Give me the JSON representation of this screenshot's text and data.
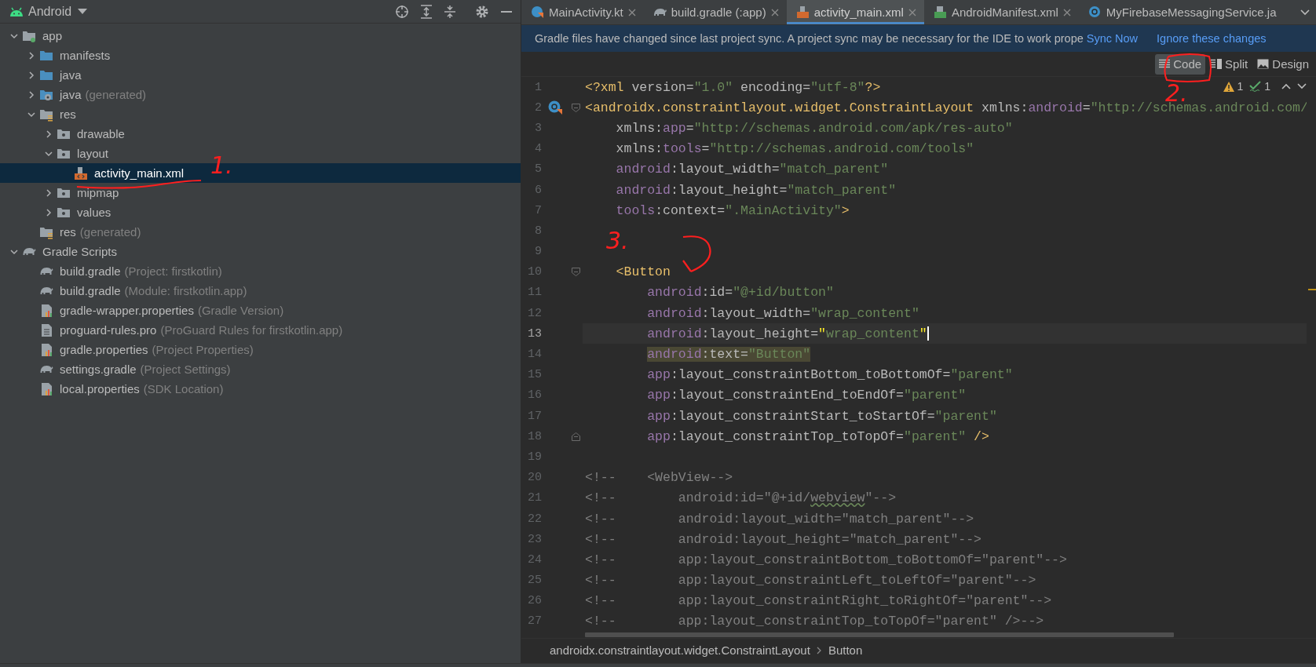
{
  "project_panel": {
    "view": "Android",
    "tree": [
      {
        "label": "app",
        "kind": "module",
        "expanded": true,
        "selected": false,
        "children": [
          {
            "label": "manifests",
            "kind": "folder-blue",
            "expanded": false,
            "selected": false
          },
          {
            "label": "java",
            "kind": "folder-blue",
            "expanded": false,
            "selected": false
          },
          {
            "label": "java",
            "note": "(generated)",
            "kind": "folder-gen",
            "expanded": false,
            "selected": false
          },
          {
            "label": "res",
            "kind": "folder-res",
            "expanded": true,
            "selected": false,
            "children": [
              {
                "label": "drawable",
                "kind": "folder",
                "expanded": false,
                "selected": false
              },
              {
                "label": "layout",
                "kind": "folder",
                "expanded": true,
                "selected": false,
                "children": [
                  {
                    "label": "activity_main.xml",
                    "kind": "xml",
                    "selected": true
                  }
                ]
              },
              {
                "label": "mipmap",
                "kind": "folder",
                "expanded": false,
                "selected": false
              },
              {
                "label": "values",
                "kind": "folder",
                "expanded": false,
                "selected": false
              }
            ]
          },
          {
            "label": "res",
            "note": "(generated)",
            "kind": "folder-res",
            "selected": false
          }
        ]
      },
      {
        "label": "Gradle Scripts",
        "kind": "gradle",
        "expanded": true,
        "selected": false,
        "children": [
          {
            "label": "build.gradle",
            "note": "(Project: firstkotlin)",
            "kind": "gradle",
            "selected": false
          },
          {
            "label": "build.gradle",
            "note": "(Module: firstkotlin.app)",
            "kind": "gradle",
            "selected": false
          },
          {
            "label": "gradle-wrapper.properties",
            "note": "(Gradle Version)",
            "kind": "properties",
            "selected": false
          },
          {
            "label": "proguard-rules.pro",
            "note": "(ProGuard Rules for firstkotlin.app)",
            "kind": "file",
            "selected": false
          },
          {
            "label": "gradle.properties",
            "note": "(Project Properties)",
            "kind": "properties",
            "selected": false
          },
          {
            "label": "settings.gradle",
            "note": "(Project Settings)",
            "kind": "gradle",
            "selected": false
          },
          {
            "label": "local.properties",
            "note": "(SDK Location)",
            "kind": "properties",
            "selected": false
          }
        ]
      }
    ]
  },
  "tabs": [
    {
      "label": "MainActivity.kt",
      "kind": "kotlin",
      "selected": false,
      "closable": true
    },
    {
      "label": "build.gradle (:app)",
      "kind": "gradle",
      "selected": false,
      "closable": true
    },
    {
      "label": "activity_main.xml",
      "kind": "xml",
      "selected": true,
      "closable": true
    },
    {
      "label": "AndroidManifest.xml",
      "kind": "manifest",
      "selected": false,
      "closable": true
    },
    {
      "label": "MyFirebaseMessagingService.ja",
      "kind": "class",
      "selected": false,
      "closable": false
    }
  ],
  "notification": {
    "message": "Gradle files have changed since last project sync. A project sync may be necessary for the IDE to work prope",
    "actions": [
      "Sync Now",
      "Ignore these changes"
    ]
  },
  "view_modes": [
    {
      "label": "Code",
      "kind": "code",
      "selected": true
    },
    {
      "label": "Split",
      "kind": "split",
      "selected": false
    },
    {
      "label": "Design",
      "kind": "design",
      "selected": false
    }
  ],
  "inspections": [
    {
      "kind": "warning",
      "count": "1"
    },
    {
      "kind": "ok",
      "count": "1"
    }
  ],
  "editor": {
    "lines": [
      {
        "number": "1",
        "kind": "normal",
        "tokens": [
          {
            "kind": "tag",
            "text": "<?xml"
          },
          {
            "kind": "attr",
            "text": " version="
          },
          {
            "kind": "str",
            "text": "\"1.0\""
          },
          {
            "kind": "attr",
            "text": " encoding="
          },
          {
            "kind": "str",
            "text": "\"utf-8\""
          },
          {
            "kind": "tag",
            "text": "?>"
          }
        ]
      },
      {
        "number": "2",
        "kind": "normal",
        "class_marker": true,
        "fold_start": true,
        "tokens": [
          {
            "kind": "tag",
            "text": "<androidx.constraintlayout.widget.ConstraintLayout"
          },
          {
            "kind": "attr",
            "text": " xmlns:"
          },
          {
            "kind": "ns",
            "text": "android"
          },
          {
            "kind": "attr",
            "text": "="
          },
          {
            "kind": "str",
            "text": "\"http://schemas.android.com/"
          }
        ]
      },
      {
        "number": "3",
        "kind": "normal",
        "tokens": [
          {
            "kind": "attr",
            "text": "    xmlns:"
          },
          {
            "kind": "ns",
            "text": "app"
          },
          {
            "kind": "attr",
            "text": "="
          },
          {
            "kind": "str",
            "text": "\"http://schemas.android.com/apk/res-auto\""
          }
        ]
      },
      {
        "number": "4",
        "kind": "normal",
        "tokens": [
          {
            "kind": "attr",
            "text": "    xmlns:"
          },
          {
            "kind": "ns",
            "text": "tools"
          },
          {
            "kind": "attr",
            "text": "="
          },
          {
            "kind": "str",
            "text": "\"http://schemas.android.com/tools\""
          }
        ]
      },
      {
        "number": "5",
        "kind": "normal",
        "tokens": [
          {
            "kind": "ns",
            "text": "    android"
          },
          {
            "kind": "attr",
            "text": ":layout_width="
          },
          {
            "kind": "str",
            "text": "\"match_parent\""
          }
        ]
      },
      {
        "number": "6",
        "kind": "normal",
        "tokens": [
          {
            "kind": "ns",
            "text": "    android"
          },
          {
            "kind": "attr",
            "text": ":layout_height="
          },
          {
            "kind": "str",
            "text": "\"match_parent\""
          }
        ]
      },
      {
        "number": "7",
        "kind": "normal",
        "tokens": [
          {
            "kind": "ns",
            "text": "    tools"
          },
          {
            "kind": "attr",
            "text": ":context="
          },
          {
            "kind": "str",
            "text": "\".MainActivity\""
          },
          {
            "kind": "tag",
            "text": ">"
          }
        ]
      },
      {
        "number": "8",
        "kind": "normal"
      },
      {
        "number": "9",
        "kind": "normal"
      },
      {
        "number": "10",
        "kind": "normal",
        "fold_start": true,
        "tokens": [
          {
            "kind": "tag",
            "text": "    <Button"
          }
        ]
      },
      {
        "number": "11",
        "kind": "normal",
        "tokens": [
          {
            "kind": "ns",
            "text": "        android"
          },
          {
            "kind": "attr",
            "text": ":id="
          },
          {
            "kind": "str",
            "text": "\"@+id/button\""
          }
        ]
      },
      {
        "number": "12",
        "kind": "normal",
        "tokens": [
          {
            "kind": "ns",
            "text": "        android"
          },
          {
            "kind": "attr",
            "text": ":layout_width="
          },
          {
            "kind": "str",
            "text": "\"wrap_content\""
          }
        ]
      },
      {
        "number": "13",
        "kind": "current",
        "tokens": [
          {
            "kind": "ns",
            "text": "        android"
          },
          {
            "kind": "attr",
            "text": ":layout_height="
          },
          {
            "kind": "match",
            "text": "\""
          },
          {
            "kind": "str",
            "text": "wrap_content"
          },
          {
            "kind": "match",
            "text": "\""
          }
        ]
      },
      {
        "number": "14",
        "kind": "highlighted",
        "tokens": [
          {
            "kind": "ns",
            "text": "        android"
          },
          {
            "kind": "attr",
            "text": ":text="
          },
          {
            "kind": "str",
            "text": "\"Button\""
          }
        ]
      },
      {
        "number": "15",
        "kind": "normal",
        "tokens": [
          {
            "kind": "ns",
            "text": "        app"
          },
          {
            "kind": "attr",
            "text": ":layout_constraintBottom_toBottomOf="
          },
          {
            "kind": "str",
            "text": "\"parent\""
          }
        ]
      },
      {
        "number": "16",
        "kind": "normal",
        "tokens": [
          {
            "kind": "ns",
            "text": "        app"
          },
          {
            "kind": "attr",
            "text": ":layout_constraintEnd_toEndOf="
          },
          {
            "kind": "str",
            "text": "\"parent\""
          }
        ]
      },
      {
        "number": "17",
        "kind": "normal",
        "tokens": [
          {
            "kind": "ns",
            "text": "        app"
          },
          {
            "kind": "attr",
            "text": ":layout_constraintStart_toStartOf="
          },
          {
            "kind": "str",
            "text": "\"parent\""
          }
        ]
      },
      {
        "number": "18",
        "kind": "normal",
        "fold_end": true,
        "tokens": [
          {
            "kind": "ns",
            "text": "        app"
          },
          {
            "kind": "attr",
            "text": ":layout_constraintTop_toTopOf="
          },
          {
            "kind": "str",
            "text": "\"parent\""
          },
          {
            "kind": "tag",
            "text": " />"
          }
        ]
      },
      {
        "number": "19",
        "kind": "normal"
      },
      {
        "number": "20",
        "kind": "normal",
        "tokens": [
          {
            "kind": "comment",
            "text": "<!--    <WebView-->"
          }
        ]
      },
      {
        "number": "21",
        "kind": "normal",
        "tokens": [
          {
            "kind": "comment",
            "text": "<!--        android:id=\"@+id/"
          },
          {
            "kind": "typo",
            "text": "webview"
          },
          {
            "kind": "comment",
            "text": "\"-->"
          }
        ]
      },
      {
        "number": "22",
        "kind": "normal",
        "tokens": [
          {
            "kind": "comment",
            "text": "<!--        android:layout_width=\"match_parent\"-->"
          }
        ]
      },
      {
        "number": "23",
        "kind": "normal",
        "tokens": [
          {
            "kind": "comment",
            "text": "<!--        android:layout_height=\"match_parent\"-->"
          }
        ]
      },
      {
        "number": "24",
        "kind": "normal",
        "tokens": [
          {
            "kind": "comment",
            "text": "<!--        app:layout_constraintBottom_toBottomOf=\"parent\"-->"
          }
        ]
      },
      {
        "number": "25",
        "kind": "normal",
        "tokens": [
          {
            "kind": "comment",
            "text": "<!--        app:layout_constraintLeft_toLeftOf=\"parent\"-->"
          }
        ]
      },
      {
        "number": "26",
        "kind": "normal",
        "tokens": [
          {
            "kind": "comment",
            "text": "<!--        app:layout_constraintRight_toRightOf=\"parent\"-->"
          }
        ]
      },
      {
        "number": "27",
        "kind": "normal",
        "tokens": [
          {
            "kind": "comment",
            "text": "<!--        app:layout_constraintTop_toTopOf=\"parent\" />-->"
          }
        ]
      }
    ]
  },
  "breadcrumbs": [
    "androidx.constraintlayout.widget.ConstraintLayout",
    "Button"
  ],
  "annotations": [
    {
      "text": "1."
    },
    {
      "text": "2."
    },
    {
      "text": "3."
    }
  ]
}
